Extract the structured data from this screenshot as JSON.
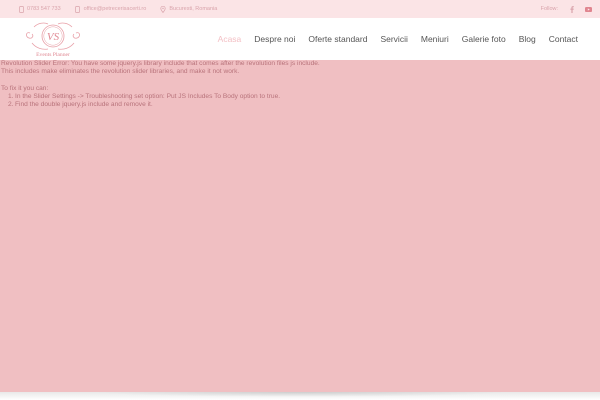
{
  "topbar": {
    "phone": "0783 547 733",
    "email": "office@petrecerisacerti.ro",
    "location": "Bucuresti, Romania",
    "follow_label": "Follow:",
    "social_icons": [
      "facebook-icon",
      "youtube-icon"
    ]
  },
  "logo": {
    "monogram": "VS",
    "tagline": "Events Planner"
  },
  "nav": {
    "items": [
      {
        "label": "Acasa",
        "active": true
      },
      {
        "label": "Despre noi",
        "active": false
      },
      {
        "label": "Oferte standard",
        "active": false
      },
      {
        "label": "Servicii",
        "active": false
      },
      {
        "label": "Meniuri",
        "active": false
      },
      {
        "label": "Galerie foto",
        "active": false
      },
      {
        "label": "Blog",
        "active": false
      },
      {
        "label": "Contact",
        "active": false
      }
    ]
  },
  "slider_error": {
    "line1": "Revolution Slider Error: You have some jquery.js library include that comes after the revolution files js include.",
    "line2": "This includes make eliminates the revolution slider libraries, and make it not work.",
    "line3": "To fix it you can:",
    "steps": [
      {
        "num": "1.",
        "text": "In the Slider Settings -> Troubleshooting set option: Put JS Includes To Body option to true."
      },
      {
        "num": "2.",
        "text": "Find the double jquery.js include and remove it."
      }
    ]
  },
  "colors": {
    "topbar_bg": "#fbe4e6",
    "slider_bg": "#f0bfc2",
    "accent": "#f3c0c5",
    "error_text": "#b8737b"
  }
}
